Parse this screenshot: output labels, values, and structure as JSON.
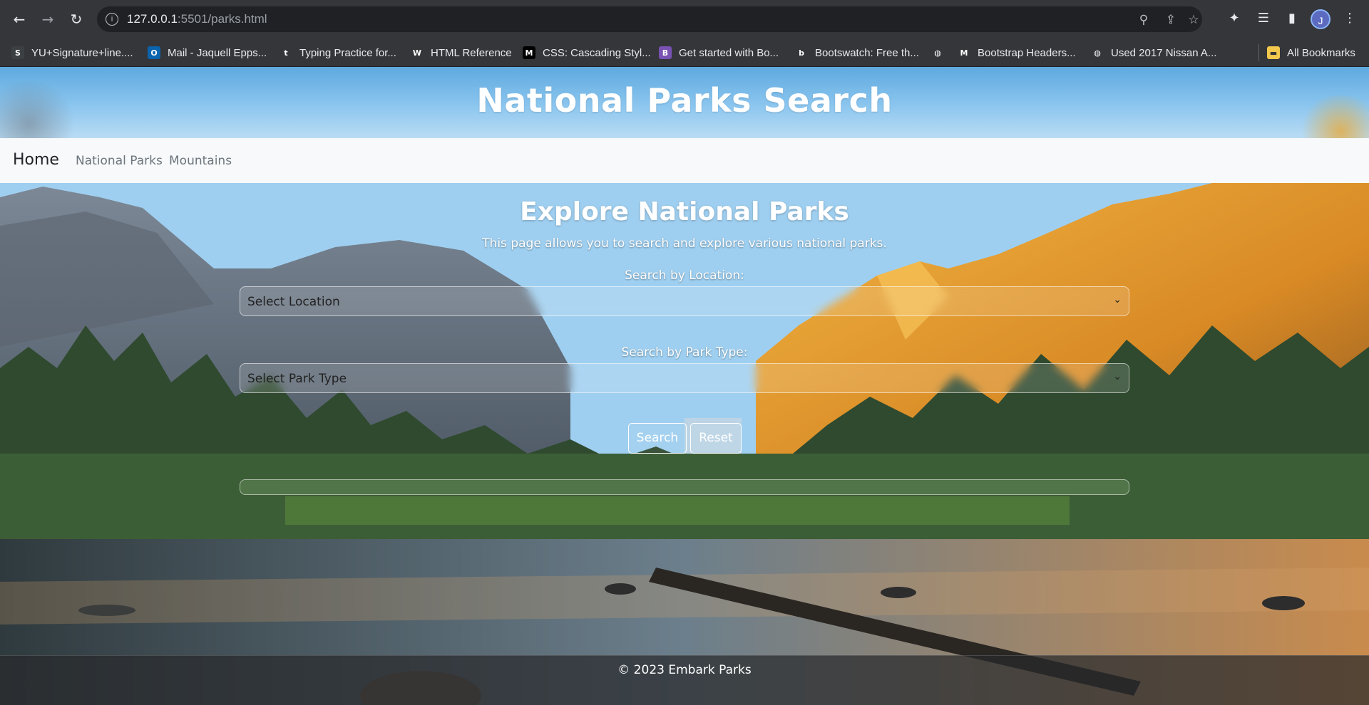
{
  "browser": {
    "url_host": "127.0.0.1",
    "url_rest": ":5501/parks.html",
    "profile_initial": "J",
    "bookmarks": [
      {
        "label": "YU+Signature+line....",
        "icon": "s-icon",
        "color": "#3c4043",
        "glyph": "S"
      },
      {
        "label": "Mail - Jaquell Epps...",
        "icon": "outlook-icon",
        "color": "#0a64ad",
        "glyph": "O"
      },
      {
        "label": "Typing Practice for...",
        "icon": "t-icon",
        "color": "#35363a",
        "glyph": "t"
      },
      {
        "label": "HTML Reference",
        "icon": "w-icon",
        "color": "#35363a",
        "glyph": "W"
      },
      {
        "label": "CSS: Cascading Styl...",
        "icon": "mdn-icon",
        "color": "#000000",
        "glyph": "M"
      },
      {
        "label": "Get started with Bo...",
        "icon": "bootstrap-icon",
        "color": "#7952b3",
        "glyph": "B"
      },
      {
        "label": "Bootswatch: Free th...",
        "icon": "bootswatch-icon",
        "color": "#35363a",
        "glyph": "b"
      },
      {
        "label": "",
        "icon": "globe-icon",
        "color": "#35363a",
        "glyph": "◍"
      },
      {
        "label": "Bootstrap Headers...",
        "icon": "mdb-icon",
        "color": "#35363a",
        "glyph": "M"
      },
      {
        "label": "Used 2017 Nissan A...",
        "icon": "globe-icon",
        "color": "#35363a",
        "glyph": "◍"
      }
    ],
    "all_bookmarks": "All Bookmarks"
  },
  "page": {
    "banner_title": "National Parks Search",
    "nav": {
      "brand": "Home",
      "links": [
        "National Parks",
        "Mountains"
      ]
    },
    "heading": "Explore National Parks",
    "lead": "This page allows you to search and explore various national parks.",
    "location_label": "Search by Location:",
    "location_value": "Select Location",
    "type_label": "Search by Park Type:",
    "type_value": "Select Park Type",
    "search_button": "Search",
    "reset_button": "Reset",
    "footer": "© 2023 Embark Parks"
  }
}
